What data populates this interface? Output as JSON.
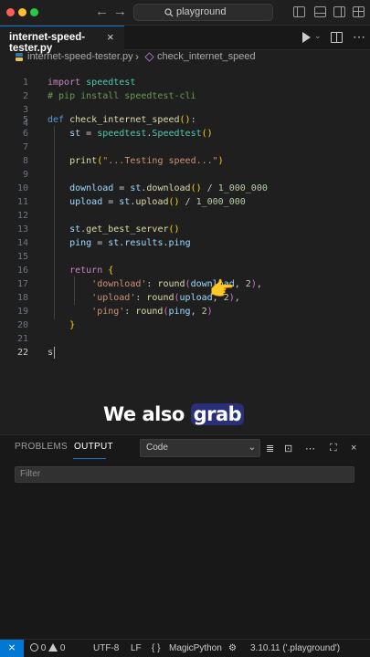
{
  "titlebar": {
    "back": "←",
    "forward": "→",
    "search": "playground"
  },
  "tab": {
    "label": "internet-speed-tester.py",
    "close": "×"
  },
  "breadcrumb": {
    "file": "internet-speed-tester.py",
    "separator": "›",
    "symbol": "check_internet_speed"
  },
  "editor": {
    "active_line": "22",
    "lines": [
      {
        "n": "1"
      },
      {
        "n": "2"
      },
      {
        "n": "3"
      },
      {
        "n": "4"
      },
      {
        "n": "5"
      },
      {
        "n": "6"
      },
      {
        "n": "7"
      },
      {
        "n": "8"
      },
      {
        "n": "9"
      },
      {
        "n": "10"
      },
      {
        "n": "11"
      },
      {
        "n": "12"
      },
      {
        "n": "13"
      },
      {
        "n": "14"
      },
      {
        "n": "15"
      },
      {
        "n": "16"
      },
      {
        "n": "17"
      },
      {
        "n": "18"
      },
      {
        "n": "19"
      },
      {
        "n": "20"
      },
      {
        "n": "21"
      },
      {
        "n": "22"
      }
    ],
    "tokens": {
      "import": "import",
      "speedtest": "speedtest",
      "comment": "# pip install speedtest-cli",
      "def": "def",
      "fn_name": "check_internet_speed",
      "paren_open": "(",
      "paren_close": ")",
      "colon": ":",
      "st": "st",
      "eq": " = ",
      "dot": ".",
      "Speedtest": "Speedtest",
      "empty_parens": "()",
      "print": "print",
      "print_str": "\"...Testing speed...\"",
      "download": "download",
      "upload": "upload",
      "div": " / ",
      "million": "1_000_000",
      "get_best_server": "get_best_server",
      "ping": "ping",
      "results": "results",
      "return": "return",
      "brace_open": "{",
      "brace_close": "}",
      "key_download": "'download'",
      "key_upload": "'upload'",
      "key_ping": "'ping'",
      "key_sep": ": ",
      "round": "round",
      "comma_two": ", ",
      "two": "2",
      "trailing_comma": ",",
      "typed": "s"
    },
    "pointer_emoji": "👉"
  },
  "caption": {
    "before": "We also ",
    "highlight": "grab"
  },
  "panel": {
    "tabs": [
      "PROBLEMS",
      "OUTPUT"
    ],
    "active_tab": "OUTPUT",
    "dropdown": "Code",
    "filter_placeholder": "Filter"
  },
  "statusbar": {
    "remote_icon": "⨯",
    "errors": "0",
    "warnings": "0",
    "encoding": "UTF-8",
    "eol": "LF",
    "language_icon": "{ }",
    "language": "MagicPython",
    "interpreter": "3.10.11 ('.playground')"
  },
  "colors": {
    "accent": "#0078d4",
    "background": "#1f1f1f",
    "keyword": "#569cd6",
    "string": "#ce9178"
  }
}
